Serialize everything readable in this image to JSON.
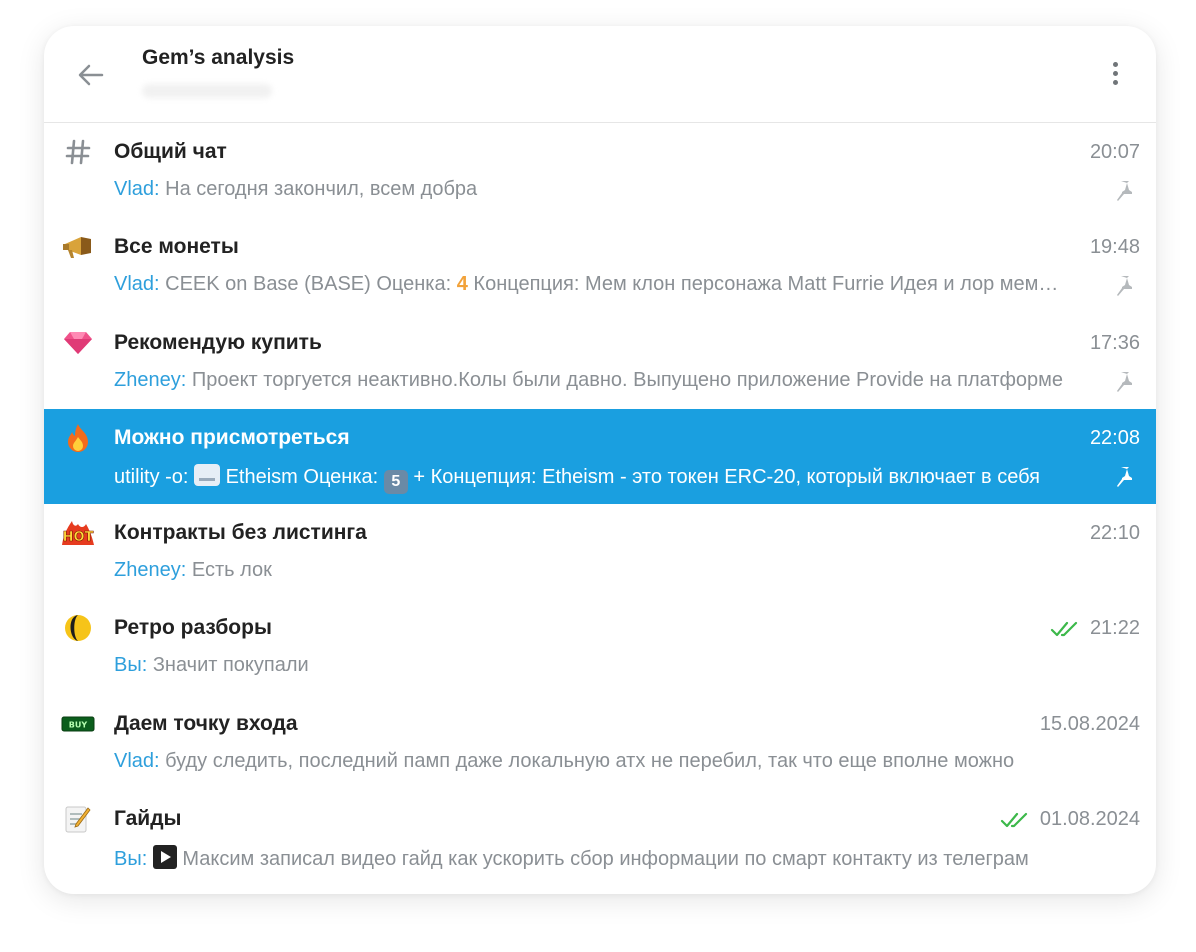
{
  "header": {
    "title": "Gem’s analysis"
  },
  "chats": [
    {
      "name": "Общий чат",
      "time": "20:07",
      "sender": "Vlad:",
      "text": " На сегодня закончил, всем добра",
      "icon": "hash-icon"
    },
    {
      "name": "Все монеты",
      "time": "19:48",
      "sender": "Vlad:",
      "text": " CEEK on Base  (BASE)  Оценка: ",
      "extra": "4",
      "text2": "  Концепция: Мем клон персонажа Matt Furrie  Идея и лор мема: трейд на Base, мем сделан по образу Бретт (Brett)",
      "icon": "megaphone-icon"
    },
    {
      "name": "Рекомендую купить",
      "time": "17:36",
      "sender": "Zheney:",
      "text": " Проект торгуется неактивно.Колы были давно. Выпущено приложение Provide на платформе",
      "icon": "gem-icon"
    },
    {
      "name": "Можно присмотреться",
      "time": "22:08",
      "sender": "utility -o:",
      "text": " Etheism  Оценка: ",
      "extra": "5",
      "text2": " +  Концепция: Etheism - это токен ERC-20, который включает в себя",
      "icon": "fire-icon"
    },
    {
      "name": "Контракты без листинга",
      "time": "22:10",
      "sender": "Zheney:",
      "text": " Есть лок",
      "icon": "hot-icon"
    },
    {
      "name": "Ретро разборы",
      "time": "21:22",
      "sender": "Вы:",
      "text": " Значит покупали",
      "icon": "moon-icon"
    },
    {
      "name": "Даем точку входа",
      "time": "15.08.2024",
      "sender": "Vlad:",
      "text": " буду следить, последний памп даже локальную атх не перебил, так что еще вполне можно",
      "icon": "buy-icon"
    },
    {
      "name": "Гайды",
      "time": "01.08.2024",
      "sender": "Вы:",
      "text": " Максим записал видео гайд как ускорить сбор информации по смарт контакту из телеграм",
      "icon": "memo-icon"
    }
  ],
  "colors": {
    "accent": "#1a9fe0",
    "sender": "#2e9fdc",
    "muted": "#8a8f94",
    "read": "#3cb84a"
  }
}
